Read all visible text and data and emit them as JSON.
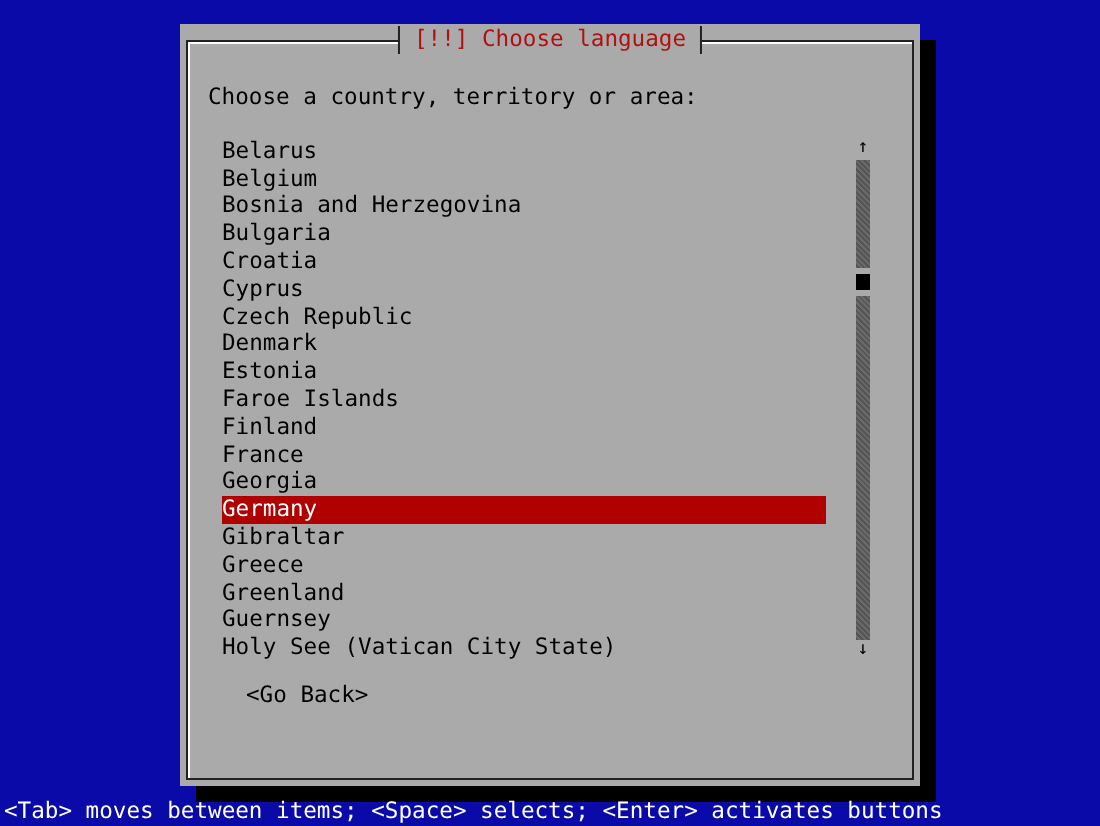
{
  "dialog": {
    "title": "[!!] Choose language",
    "prompt": "Choose a country, territory or area:",
    "items": [
      {
        "label": "Belarus",
        "selected": false
      },
      {
        "label": "Belgium",
        "selected": false
      },
      {
        "label": "Bosnia and Herzegovina",
        "selected": false
      },
      {
        "label": "Bulgaria",
        "selected": false
      },
      {
        "label": "Croatia",
        "selected": false
      },
      {
        "label": "Cyprus",
        "selected": false
      },
      {
        "label": "Czech Republic",
        "selected": false
      },
      {
        "label": "Denmark",
        "selected": false
      },
      {
        "label": "Estonia",
        "selected": false
      },
      {
        "label": "Faroe Islands",
        "selected": false
      },
      {
        "label": "Finland",
        "selected": false
      },
      {
        "label": "France",
        "selected": false
      },
      {
        "label": "Georgia",
        "selected": false
      },
      {
        "label": "Germany",
        "selected": true
      },
      {
        "label": "Gibraltar",
        "selected": false
      },
      {
        "label": "Greece",
        "selected": false
      },
      {
        "label": "Greenland",
        "selected": false
      },
      {
        "label": "Guernsey",
        "selected": false
      },
      {
        "label": "Holy See (Vatican City State)",
        "selected": false
      }
    ],
    "scroll_up": "↑",
    "scroll_down": "↓",
    "button": "<Go Back>"
  },
  "help_line": "<Tab> moves between items; <Space> selects; <Enter> activates buttons"
}
